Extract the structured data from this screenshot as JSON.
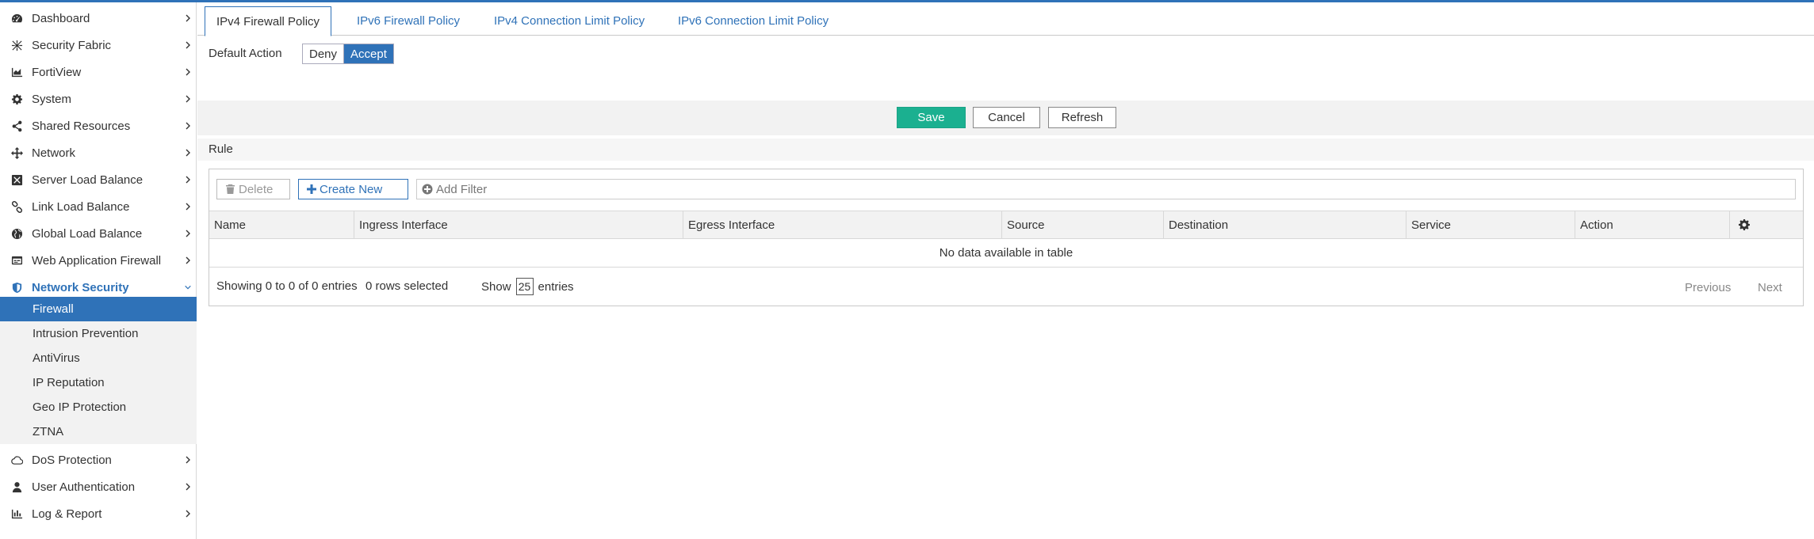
{
  "sidebar": {
    "items": [
      {
        "label": "Dashboard",
        "icon": "dashboard-icon"
      },
      {
        "label": "Security Fabric",
        "icon": "security-fabric-icon"
      },
      {
        "label": "FortiView",
        "icon": "chart-area-icon"
      },
      {
        "label": "System",
        "icon": "gear-icon"
      },
      {
        "label": "Shared Resources",
        "icon": "share-icon"
      },
      {
        "label": "Network",
        "icon": "arrows-move-icon"
      },
      {
        "label": "Server Load Balance",
        "icon": "server-lb-icon"
      },
      {
        "label": "Link Load Balance",
        "icon": "link-icon"
      },
      {
        "label": "Global Load Balance",
        "icon": "globe-icon"
      },
      {
        "label": "Web Application Firewall",
        "icon": "waf-icon"
      },
      {
        "label": "Network Security",
        "icon": "shield-icon"
      },
      {
        "label": "DoS Protection",
        "icon": "cloud-icon"
      },
      {
        "label": "User Authentication",
        "icon": "user-icon"
      },
      {
        "label": "Log & Report",
        "icon": "bar-chart-icon"
      }
    ],
    "sub_items": [
      {
        "label": "Firewall"
      },
      {
        "label": "Intrusion Prevention"
      },
      {
        "label": "AntiVirus"
      },
      {
        "label": "IP Reputation"
      },
      {
        "label": "Geo IP Protection"
      },
      {
        "label": "ZTNA"
      }
    ]
  },
  "tabs": [
    {
      "label": "IPv4 Firewall Policy"
    },
    {
      "label": "IPv6 Firewall Policy"
    },
    {
      "label": "IPv4 Connection Limit Policy"
    },
    {
      "label": "IPv6 Connection Limit Policy"
    }
  ],
  "default_action": {
    "label": "Default Action",
    "deny": "Deny",
    "accept": "Accept",
    "selected": "Accept"
  },
  "actions": {
    "save": "Save",
    "cancel": "Cancel",
    "refresh": "Refresh"
  },
  "rule": {
    "title": "Rule",
    "delete": "Delete",
    "create_new": "Create New",
    "filter_placeholder": "Add Filter",
    "columns": [
      "Name",
      "Ingress Interface",
      "Egress Interface",
      "Source",
      "Destination",
      "Service",
      "Action"
    ],
    "empty_text": "No data available in table",
    "showing": "Showing 0 to 0 of 0 entries",
    "selected": "0 rows selected",
    "show_label": "Show",
    "page_size": "25",
    "entries_label": "entries",
    "previous": "Previous",
    "next": "Next"
  },
  "colors": {
    "accent": "#2f72b8",
    "save": "#1bb090"
  }
}
